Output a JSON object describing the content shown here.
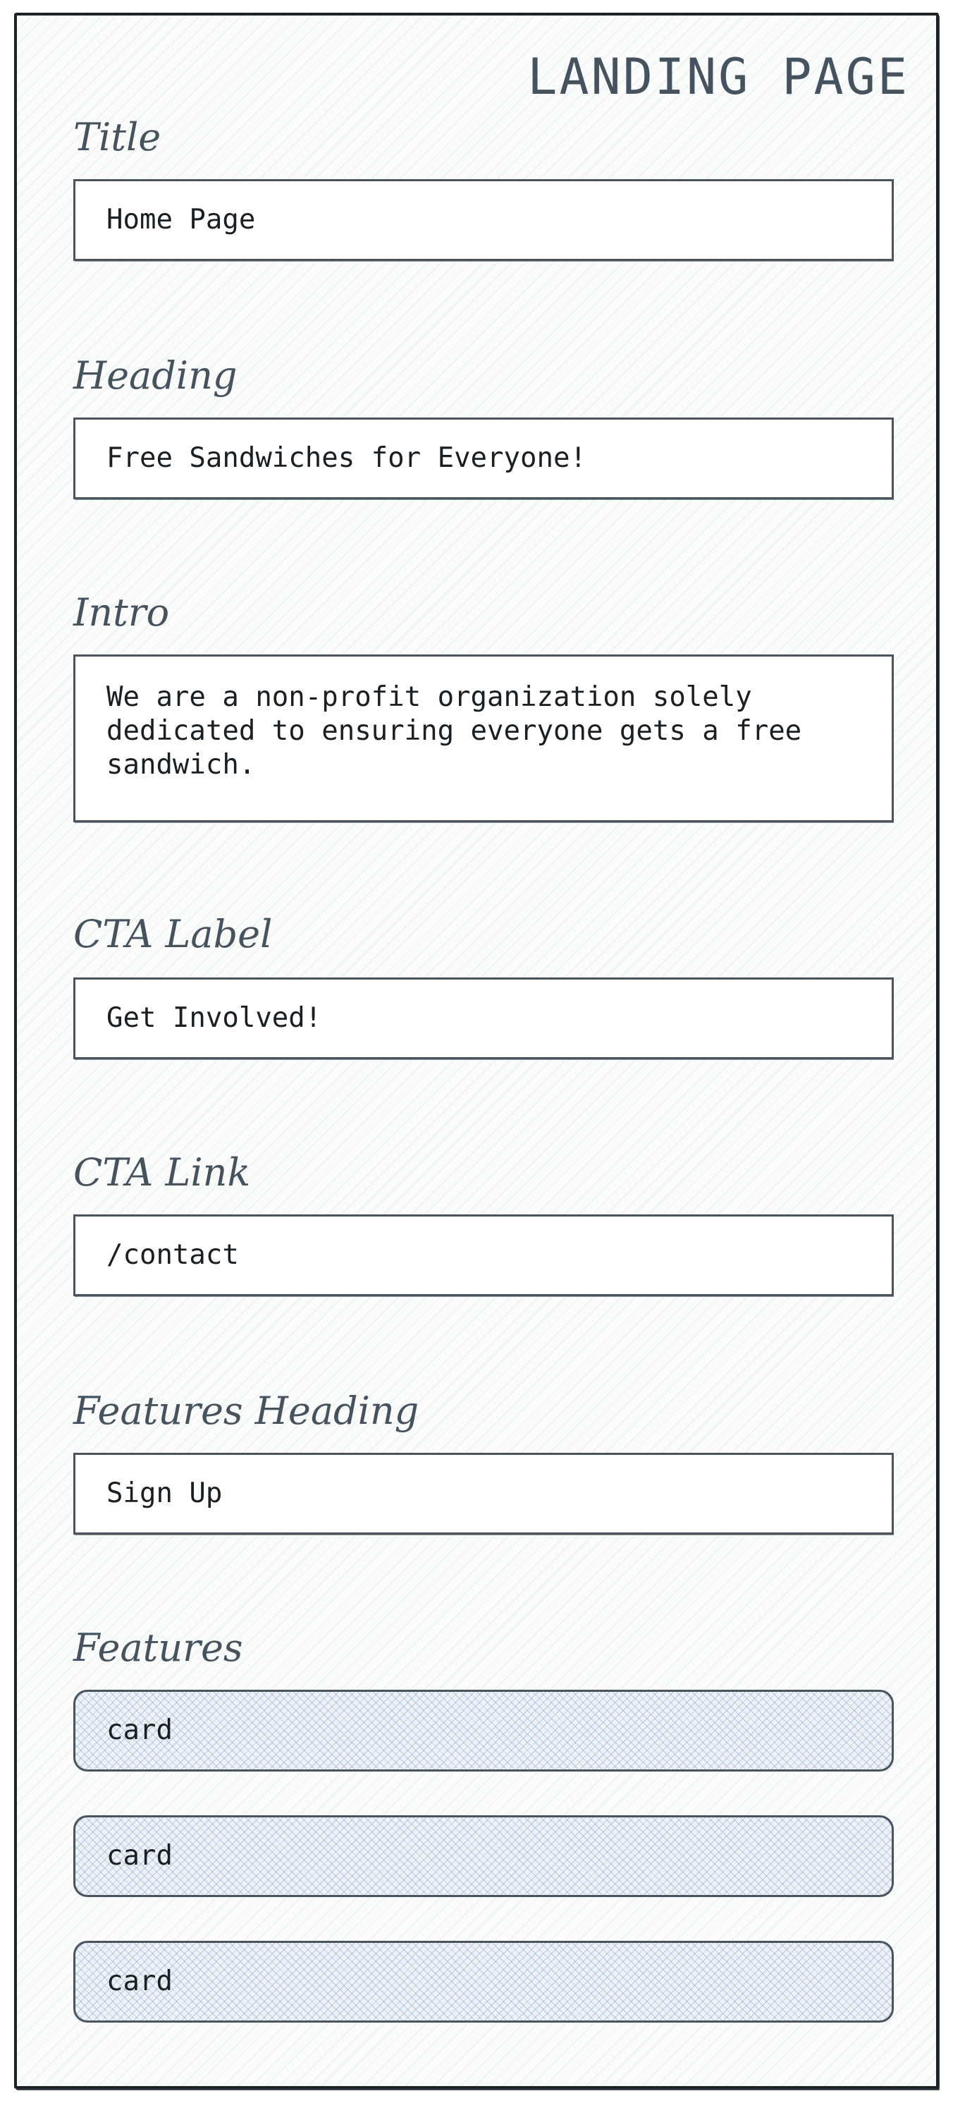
{
  "page": {
    "title": "LANDING PAGE"
  },
  "fields": {
    "title": {
      "label": "Title",
      "value": "Home Page"
    },
    "heading": {
      "label": "Heading",
      "value": "Free Sandwiches for Everyone!"
    },
    "intro": {
      "label": "Intro",
      "value": "We are a non-profit organization solely dedicated to ensuring everyone gets a free sandwich."
    },
    "cta_label": {
      "label": "CTA Label",
      "value": "Get Involved!"
    },
    "cta_link": {
      "label": "CTA Link",
      "value": "/contact"
    },
    "features_heading": {
      "label": "Features Heading",
      "value": "Sign Up"
    }
  },
  "features": {
    "label": "Features",
    "cards": [
      "card",
      "card",
      "card"
    ]
  }
}
